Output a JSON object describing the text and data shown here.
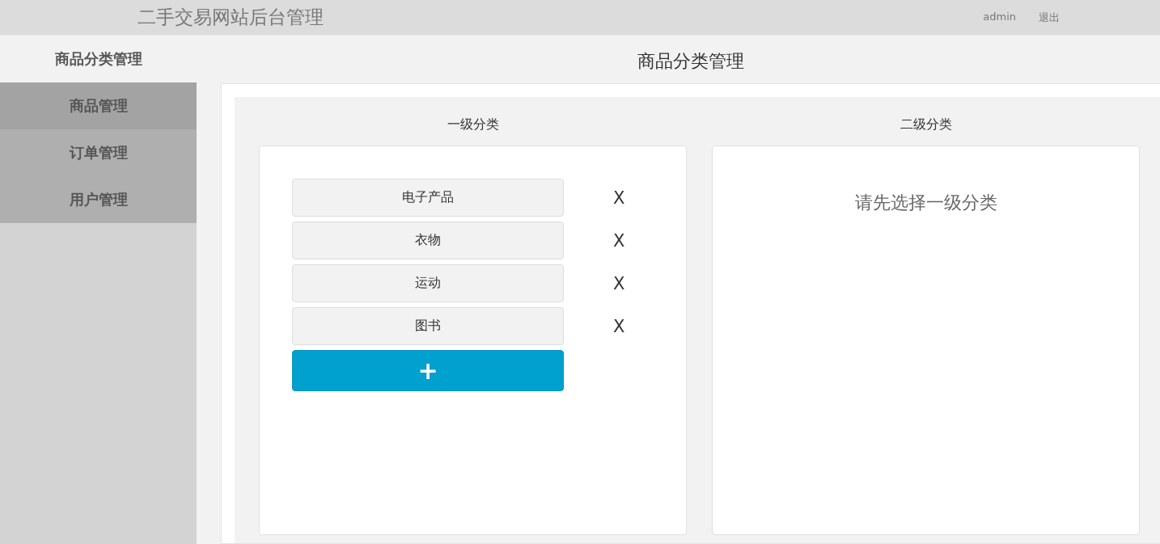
{
  "header": {
    "title": "二手交易网站后台管理",
    "user": "admin",
    "logout": "退出"
  },
  "sidebar": {
    "items": [
      {
        "label": "商品分类管理",
        "selected": true,
        "hovered": false
      },
      {
        "label": "商品管理",
        "selected": false,
        "hovered": true
      },
      {
        "label": "订单管理",
        "selected": false,
        "hovered": false
      },
      {
        "label": "用户管理",
        "selected": false,
        "hovered": false
      }
    ]
  },
  "page_title": "商品分类管理",
  "primary": {
    "heading": "一级分类",
    "categories": [
      {
        "label": "电子产品",
        "delete": "X"
      },
      {
        "label": "衣物",
        "delete": "X"
      },
      {
        "label": "运动",
        "delete": "X"
      },
      {
        "label": "图书",
        "delete": "X"
      }
    ],
    "add": "+"
  },
  "secondary": {
    "heading": "二级分类",
    "empty_message": "请先选择一级分类"
  }
}
